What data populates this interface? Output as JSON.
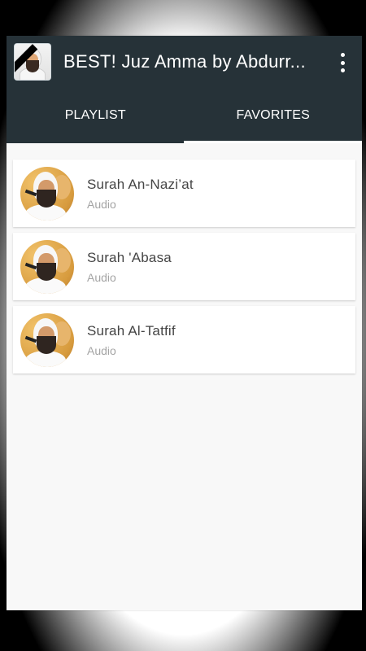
{
  "app": {
    "title": "BEST! Juz Amma by Abdurr...",
    "icon": "reciter-app-icon",
    "menu_icon": "more-vert-icon"
  },
  "tabs": [
    {
      "label": "PLAYLIST",
      "selected": false
    },
    {
      "label": "FAVORITES",
      "selected": true
    }
  ],
  "favorites": [
    {
      "title": "Surah An-Nazi’at",
      "subtitle": "Audio"
    },
    {
      "title": "Surah 'Abasa",
      "subtitle": "Audio"
    },
    {
      "title": "Surah Al-Tatfif",
      "subtitle": "Audio"
    }
  ],
  "colors": {
    "appbar": "#263238",
    "indicator": "#ffffff",
    "background": "#f8f8f8"
  }
}
